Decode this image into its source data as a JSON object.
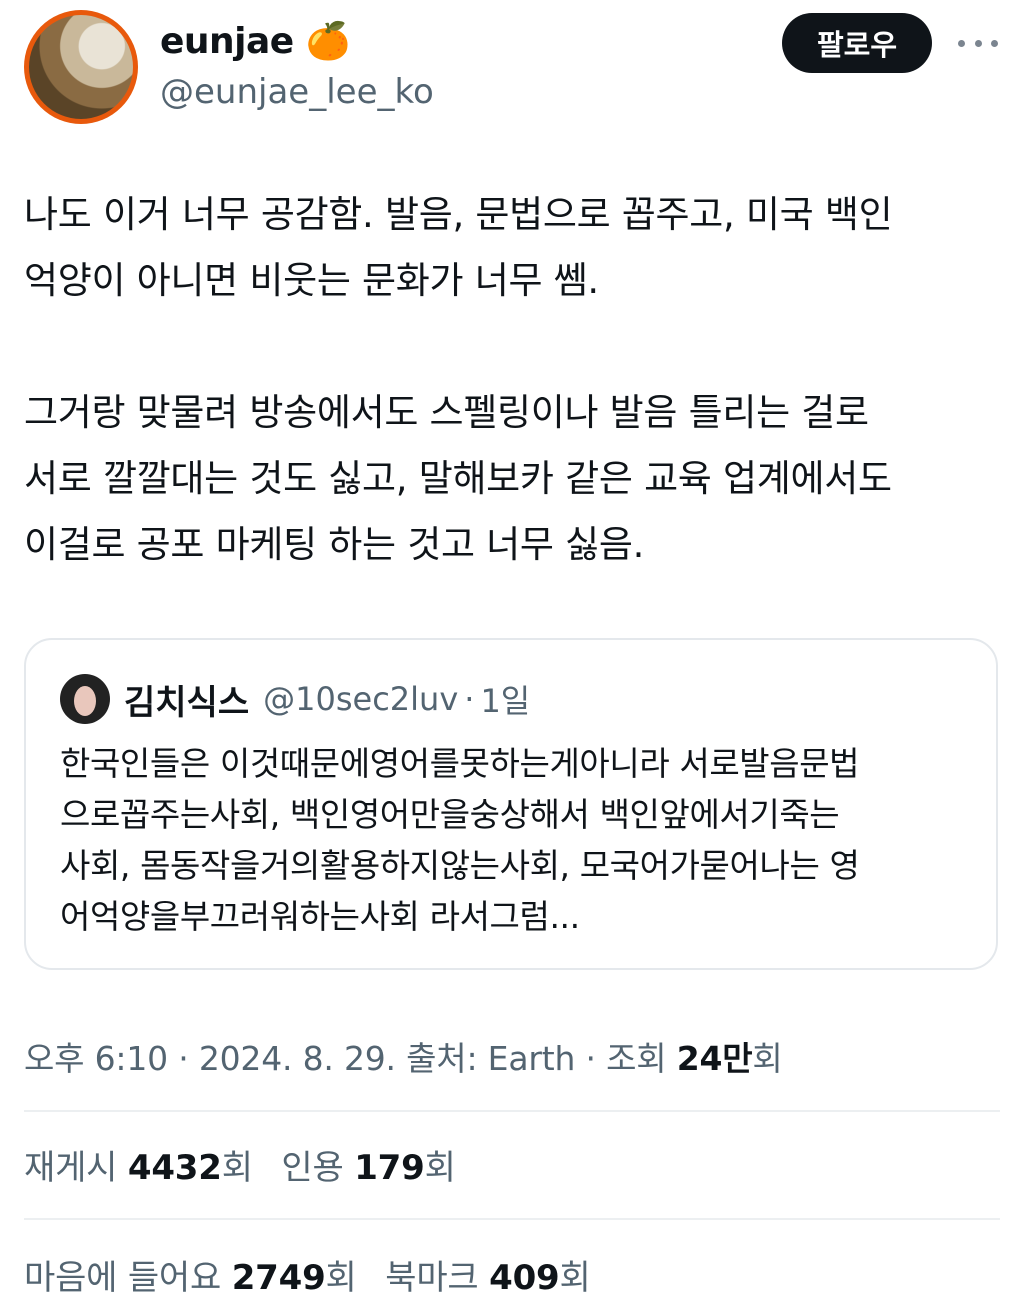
{
  "author": {
    "display_name": "eunjae",
    "emoji": "🍊",
    "handle": "@eunjae_lee_ko"
  },
  "follow_label": "팔로우",
  "tweet": {
    "lines": [
      "나도 이거 너무 공감함. 발음, 문법으로 꼽주고, 미국 백인",
      "억양이 아니면 비웃는 문화가 너무 쎔.",
      "",
      "그거랑 맞물려 방송에서도 스펠링이나 발음 틀리는 걸로",
      "서로 깔깔대는 것도 싫고, 말해보카 같은 교육 업계에서도",
      "이걸로 공포 마케팅 하는 것고 너무 싫음."
    ]
  },
  "quote": {
    "name": "김치식스",
    "handle": "@10sec2luv",
    "separator": "·",
    "time": "1일",
    "lines": [
      "한국인들은 이것때문에영어를못하는게아니라 서로발음문법",
      "으로꼽주는사회, 백인영어만을숭상해서 백인앞에서기죽는",
      "사회, 몸동작을거의활용하지않는사회, 모국어가묻어나는 영",
      "어억양을부끄러워하는사회 라서그럼..."
    ]
  },
  "meta": {
    "time": "오후 6:10",
    "date": "2024. 8. 29.",
    "source_label": "출처: Earth",
    "views_label": "조회",
    "views_value": "24만",
    "views_suffix": "회"
  },
  "stats": {
    "reposts_label": "재게시",
    "reposts_value": "4432",
    "quotes_label": "인용",
    "quotes_value": "179",
    "likes_label": "마음에 들어요",
    "likes_value": "2749",
    "bookmarks_label": "북마크",
    "bookmarks_value": "409",
    "unit": "회"
  },
  "colors": {
    "follow_bg": "#0f1419",
    "secondary_text": "#536471",
    "avatar_ring": "#e8590c"
  }
}
